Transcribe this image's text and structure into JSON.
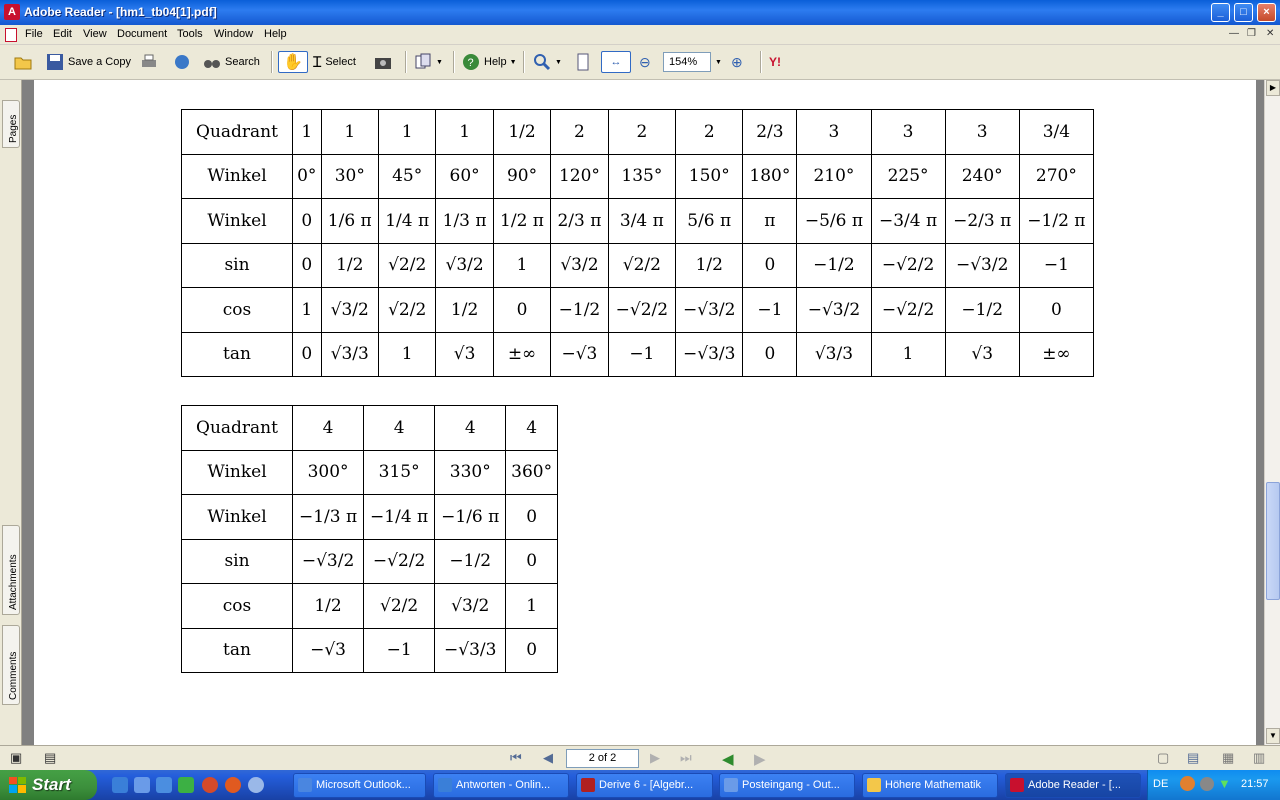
{
  "window": {
    "title": "Adobe Reader - [hm1_tb04[1].pdf]"
  },
  "menu": [
    "File",
    "Edit",
    "View",
    "Document",
    "Tools",
    "Window",
    "Help"
  ],
  "toolbar": {
    "save_copy": "Save a Copy",
    "select": "Select",
    "search": "Search",
    "help": "Help",
    "zoom": "154%"
  },
  "sidebar": {
    "tabs": [
      "Pages",
      "Attachments",
      "Comments"
    ]
  },
  "table1": {
    "rows": [
      [
        "Quadrant",
        "1",
        "1",
        "1",
        "1",
        "1/2",
        "2",
        "2",
        "2",
        "2/3",
        "3",
        "3",
        "3",
        "3/4"
      ],
      [
        "Winkel",
        "0°",
        "30°",
        "45°",
        "60°",
        "90°",
        "120°",
        "135°",
        "150°",
        "180°",
        "210°",
        "225°",
        "240°",
        "270°"
      ],
      [
        "Winkel",
        "0",
        "1/6 π",
        "1/4 π",
        "1/3 π",
        "1/2 π",
        "2/3 π",
        "3/4 π",
        "5/6 π",
        "π",
        "−5/6 π",
        "−3/4 π",
        "−2/3 π",
        "−1/2 π"
      ],
      [
        "sin",
        "0",
        "1/2",
        "√2/2",
        "√3/2",
        "1",
        "√3/2",
        "√2/2",
        "1/2",
        "0",
        "−1/2",
        "−√2/2",
        "−√3/2",
        "−1"
      ],
      [
        "cos",
        "1",
        "√3/2",
        "√2/2",
        "1/2",
        "0",
        "−1/2",
        "−√2/2",
        "−√3/2",
        "−1",
        "−√3/2",
        "−√2/2",
        "−1/2",
        "0"
      ],
      [
        "tan",
        "0",
        "√3/3",
        "1",
        "√3",
        "±∞",
        "−√3",
        "−1",
        "−√3/3",
        "0",
        "√3/3",
        "1",
        "√3",
        "±∞"
      ]
    ]
  },
  "table2": {
    "rows": [
      [
        "Quadrant",
        "4",
        "4",
        "4",
        "4"
      ],
      [
        "Winkel",
        "300°",
        "315°",
        "330°",
        "360°"
      ],
      [
        "Winkel",
        "−1/3 π",
        "−1/4 π",
        "−1/6 π",
        "0"
      ],
      [
        "sin",
        "−√3/2",
        "−√2/2",
        "−1/2",
        "0"
      ],
      [
        "cos",
        "1/2",
        "√2/2",
        "√3/2",
        "1"
      ],
      [
        "tan",
        "−√3",
        "−1",
        "−√3/3",
        "0"
      ]
    ]
  },
  "status": {
    "page": "2 of 2"
  },
  "taskbar": {
    "start": "Start",
    "tasks": [
      "Microsoft Outlook...",
      "Antworten - Onlin...",
      "Derive 6 - [Algebr...",
      "Posteingang - Out...",
      "Höhere Mathematik",
      "Adobe Reader - [..."
    ],
    "lang": "DE",
    "clock": "21:57"
  }
}
